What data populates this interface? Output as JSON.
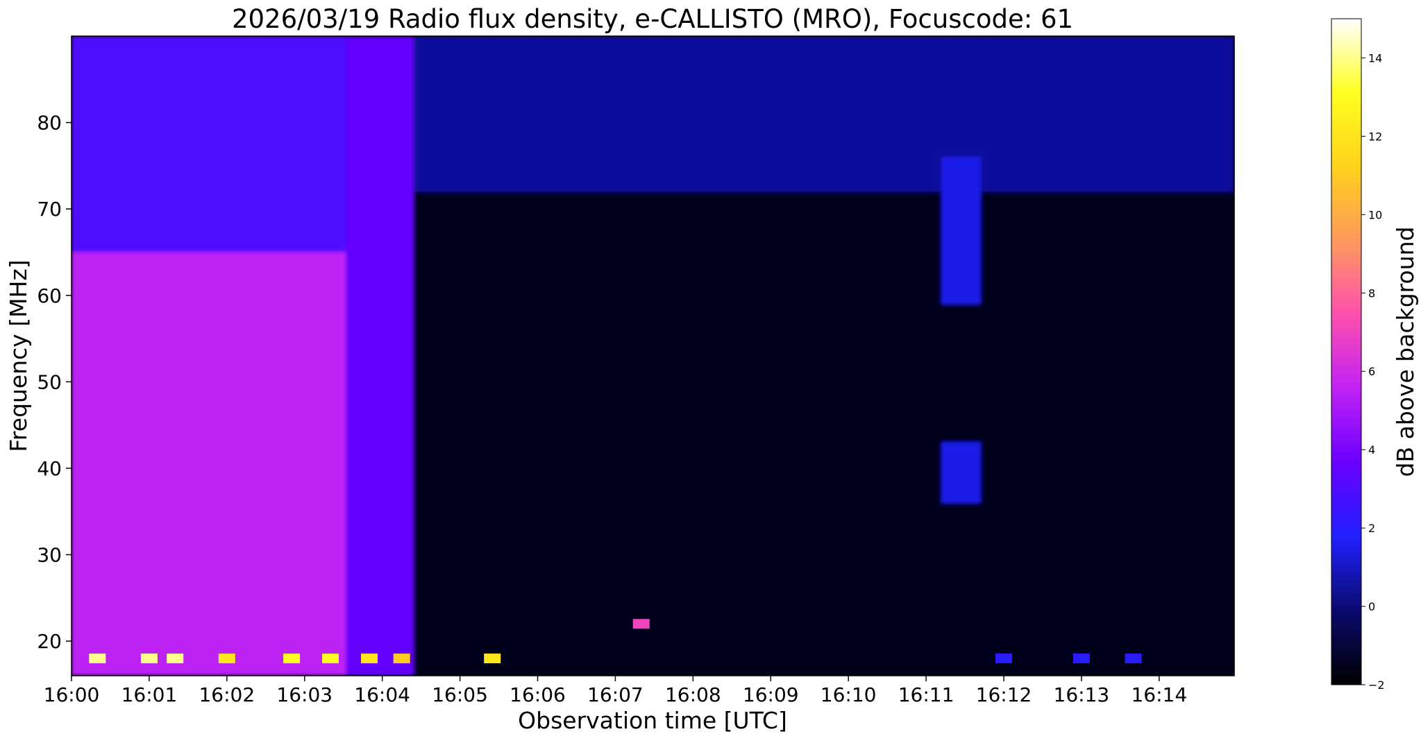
{
  "chart_data": {
    "type": "heatmap",
    "title": "2026/03/19  Radio flux density, e-CALLISTO (MRO), Focuscode: 61",
    "xlabel": "Observation time [UTC]",
    "ylabel": "Frequency [MHz]",
    "colorbar_label": "dB above background",
    "colormap": "gnuplot2",
    "colormap_stops": [
      "#000000",
      "#0a0a6e",
      "#2020ff",
      "#6a00ff",
      "#c021f5",
      "#ff4fae",
      "#ff9a5e",
      "#ffd21a",
      "#ffff20",
      "#ffffff"
    ],
    "grid": false,
    "x_range": [
      "16:00:00",
      "16:14:58"
    ],
    "y_range": [
      16,
      90
    ],
    "x_ticks": [
      "16:00",
      "16:01",
      "16:02",
      "16:03",
      "16:04",
      "16:05",
      "16:06",
      "16:07",
      "16:08",
      "16:09",
      "16:10",
      "16:11",
      "16:12",
      "16:13",
      "16:14"
    ],
    "y_ticks": [
      20,
      30,
      40,
      50,
      60,
      70,
      80
    ],
    "color_range": [
      -2,
      15
    ],
    "color_ticks": [
      -2,
      0,
      2,
      4,
      6,
      8,
      10,
      12,
      14
    ],
    "regions": [
      {
        "time_start": "16:00:00",
        "time_end": "16:03:32",
        "freq_low": 16,
        "freq_high": 65,
        "db": 5.5
      },
      {
        "time_start": "16:00:00",
        "time_end": "16:03:32",
        "freq_low": 65,
        "freq_high": 90,
        "db": 3.0
      },
      {
        "time_start": "16:03:32",
        "time_end": "16:04:24",
        "freq_low": 16,
        "freq_high": 90,
        "db": 3.5
      },
      {
        "time_start": "16:04:24",
        "time_end": "16:14:58",
        "freq_low": 16,
        "freq_high": 72,
        "db": -1.5
      },
      {
        "time_start": "16:04:24",
        "time_end": "16:14:58",
        "freq_low": 72,
        "freq_high": 90,
        "db": 0.5
      },
      {
        "time_start": "16:11:12",
        "time_end": "16:11:42",
        "freq_low": 59,
        "freq_high": 76,
        "db": 1.5
      },
      {
        "time_start": "16:11:12",
        "time_end": "16:11:42",
        "freq_low": 36,
        "freq_high": 43,
        "db": 1.5
      }
    ],
    "bursts": [
      {
        "time": "16:00:20",
        "freq": 18,
        "db": 14
      },
      {
        "time": "16:01:00",
        "freq": 18,
        "db": 14
      },
      {
        "time": "16:01:20",
        "freq": 18,
        "db": 14
      },
      {
        "time": "16:02:00",
        "freq": 18,
        "db": 12
      },
      {
        "time": "16:02:50",
        "freq": 18,
        "db": 13
      },
      {
        "time": "16:03:20",
        "freq": 18,
        "db": 13
      },
      {
        "time": "16:03:50",
        "freq": 18,
        "db": 12
      },
      {
        "time": "16:04:15",
        "freq": 18,
        "db": 11
      },
      {
        "time": "16:05:25",
        "freq": 18,
        "db": 12
      },
      {
        "time": "16:07:20",
        "freq": 22,
        "db": 7
      },
      {
        "time": "16:12:00",
        "freq": 18,
        "db": 2
      },
      {
        "time": "16:13:00",
        "freq": 18,
        "db": 2
      },
      {
        "time": "16:13:40",
        "freq": 18,
        "db": 2
      }
    ]
  }
}
